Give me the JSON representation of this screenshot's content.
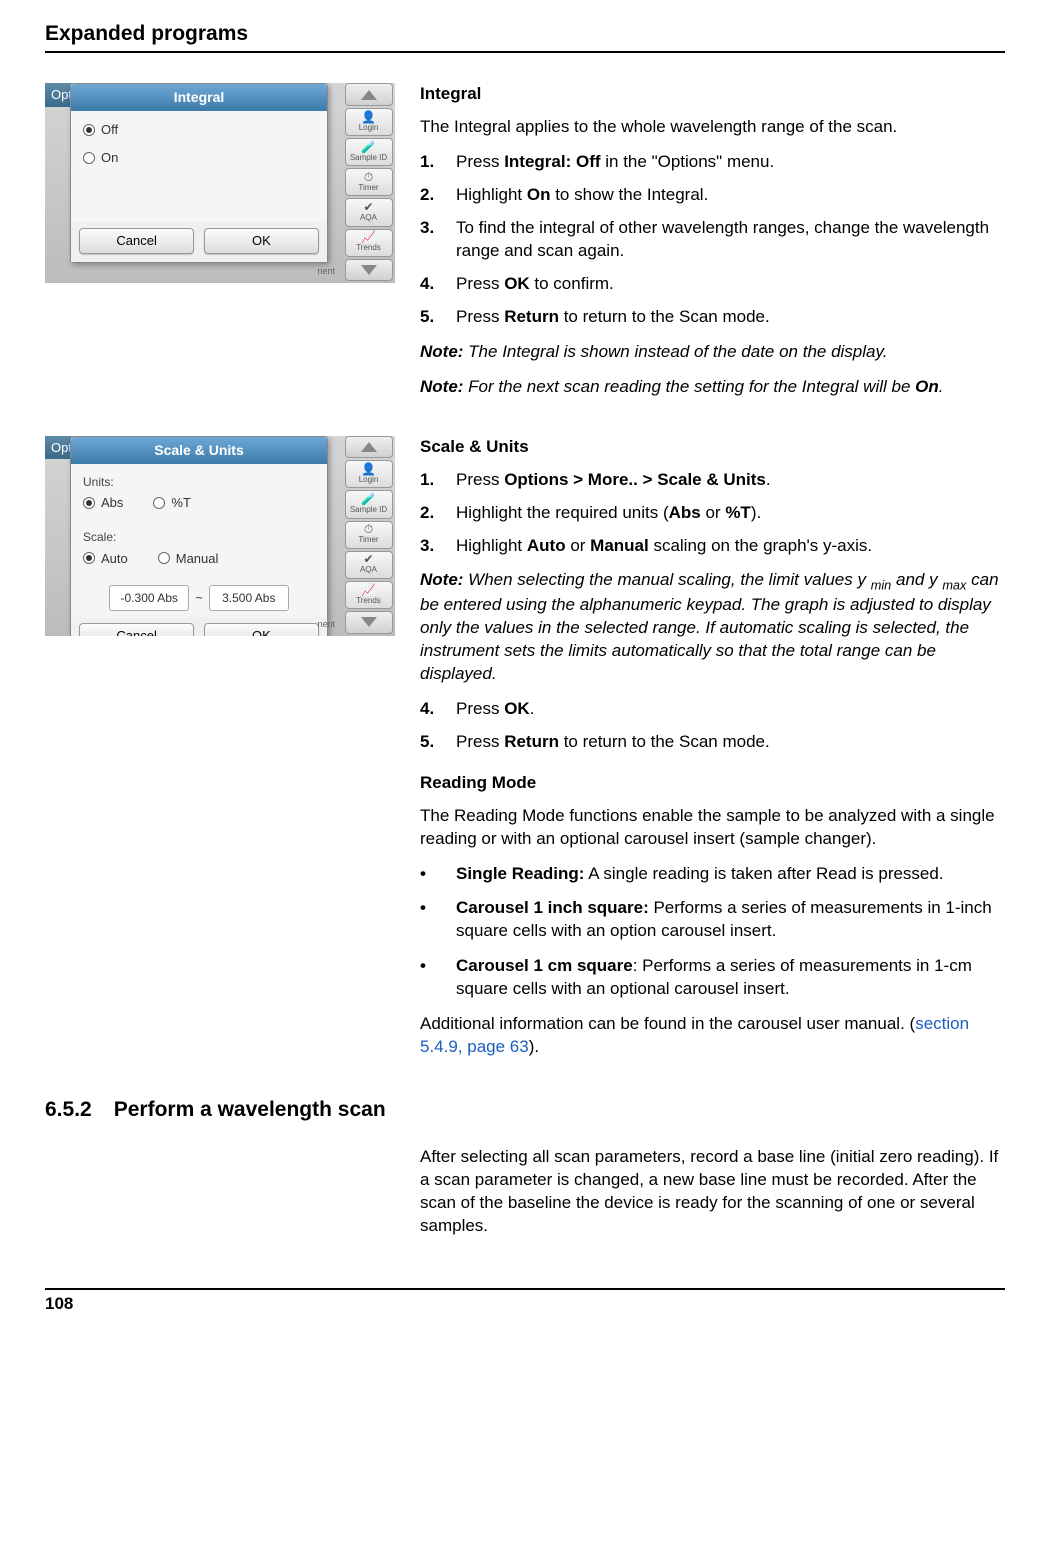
{
  "header": "Expanded programs",
  "page_number": "108",
  "screenshot1": {
    "options_label": "Options",
    "dialog_title": "Integral",
    "radio_off": "Off",
    "radio_on": "On",
    "btn_cancel": "Cancel",
    "btn_ok": "OK",
    "side": {
      "login": "Login",
      "sample": "Sample ID",
      "timer": "Timer",
      "aqa": "AQA",
      "trends": "Trends"
    },
    "remnant": "nent"
  },
  "integral": {
    "title": "Integral",
    "intro": "The Integral applies to the whole wavelength range of the scan.",
    "s1a": "Press ",
    "s1b": "Integral: Off",
    "s1c": " in the \"Options\" menu.",
    "s2a": "Highlight ",
    "s2b": "On",
    "s2c": " to show the Integral.",
    "s3": "To find the integral of other wavelength ranges, change the wavelength range and scan again.",
    "s4a": "Press ",
    "s4b": "OK",
    "s4c": " to confirm.",
    "s5a": "Press ",
    "s5b": "Return",
    "s5c": " to return to the Scan mode.",
    "note1a": "Note:",
    "note1b": " The Integral is shown instead of the date on the display.",
    "note2a": "Note:",
    "note2b": " For the next scan reading the setting for the Integral will be ",
    "note2c": "On",
    "note2d": "."
  },
  "screenshot2": {
    "options_label": "Options",
    "dialog_title": "Scale & Units",
    "units_label": "Units:",
    "abs": "Abs",
    "pt": "%T",
    "scale_label": "Scale:",
    "auto": "Auto",
    "manual": "Manual",
    "val1": "-0.300 Abs",
    "val2": "3.500 Abs",
    "tilde": "~",
    "btn_cancel": "Cancel",
    "btn_ok": "OK",
    "remnant": "nent"
  },
  "scale": {
    "title": "Scale & Units",
    "s1a": "Press ",
    "s1b": "Options > More.. > Scale & Units",
    "s1c": ".",
    "s2a": "Highlight the required units (",
    "s2b": "Abs",
    "s2c": " or ",
    "s2d": "%T",
    "s2e": ").",
    "s3a": "Highlight ",
    "s3b": "Auto",
    "s3c": " or ",
    "s3d": "Manual",
    "s3e": " scaling on the graph's y-axis.",
    "note_a": "Note:",
    "note_b": " When selecting the manual scaling, the limit values y ",
    "note_min": "min",
    "note_c": " and y ",
    "note_max": "max",
    "note_d": " can be entered using the alphanumeric keypad. The graph is adjusted to display only the values in the selected range. If automatic scaling is selected, the instrument sets the limits automatically so that the total range can be displayed.",
    "s4a": "Press ",
    "s4b": "OK",
    "s4c": ".",
    "s5a": "Press ",
    "s5b": "Return",
    "s5c": " to return to the Scan mode."
  },
  "reading": {
    "title": "Reading Mode",
    "intro": "The Reading Mode functions enable the sample to be analyzed with a single reading or with an optional carousel insert (sample changer).",
    "b1a": "Single Reading:",
    "b1b": " A single reading is taken after Read is pressed.",
    "b2a": "Carousel 1 inch square:",
    "b2b": " Performs a series of measurements in 1-inch square cells with an option carousel insert.",
    "b3a": "Carousel 1 cm square",
    "b3b": ": Performs a series of measurements in 1-cm square cells with an optional carousel insert.",
    "addl_a": "Additional information can be found in the carousel user manual. (",
    "addl_link": "section 5.4.9, page 63",
    "addl_b": ")."
  },
  "section": {
    "num": "6.5.2",
    "title": "Perform a wavelength scan",
    "para": "After selecting all scan parameters, record a base line (initial zero reading). If a scan parameter is changed, a new base line must be recorded. After the scan of the baseline the device is ready for the scanning of one or several samples."
  }
}
